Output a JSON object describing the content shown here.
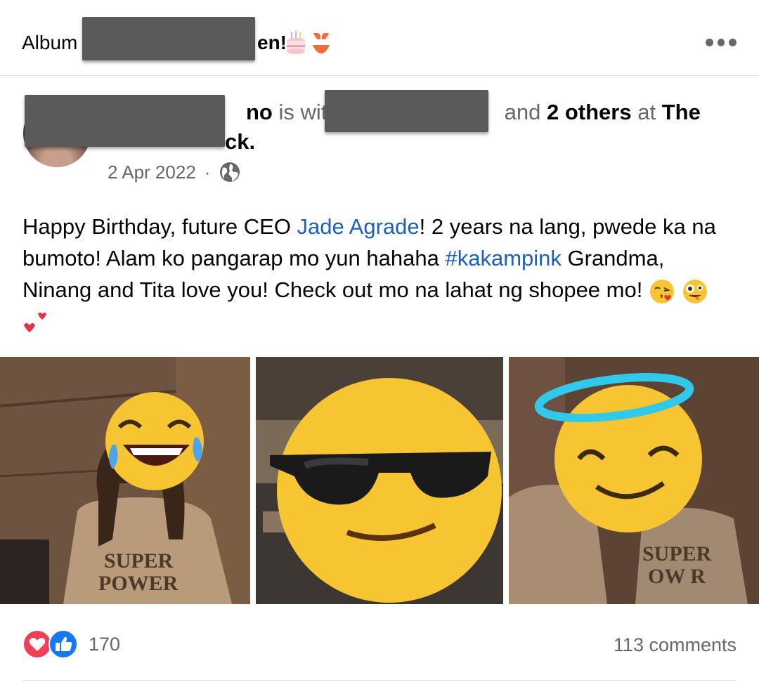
{
  "header": {
    "album_prefix": "Album",
    "album_suffix": "en!",
    "album_emojis": [
      "cake-icon",
      "bikini-icon"
    ]
  },
  "post": {
    "author_suffix": "no",
    "is_with_text": "is wit",
    "and_text": "and",
    "others_text": "2 others",
    "at_text": "at",
    "place_start": "The",
    "place_end": "ck.",
    "date": "2 Apr 2022",
    "separator": "·",
    "text": {
      "part1": "Happy Birthday, future CEO ",
      "mention": "Jade Agrade",
      "part2": "! 2 years na lang, pwede ka na bumoto! Alam ko pangarap mo yun hahaha ",
      "hashtag": "#kakampink",
      "part3": " Grandma, Ninang and Tita love you! Check out mo na lahat ng shopee mo! "
    },
    "photos": [
      {
        "sticker": "laughing-tears-emoji",
        "shirt_text": [
          "SUPER",
          "POWER"
        ]
      },
      {
        "sticker": "sunglasses-emoji"
      },
      {
        "sticker": "halo-smile-emoji",
        "shirt_text": [
          "SUPER",
          "OW R"
        ]
      }
    ]
  },
  "footer": {
    "reaction_count": "170",
    "comments": "113 comments",
    "reaction_icons": [
      "love-icon",
      "like-icon"
    ]
  },
  "colors": {
    "link": "#1d5fbf",
    "secondary_text": "#65676b",
    "like_blue": "#1877f2",
    "love_red": "#f33e58"
  }
}
